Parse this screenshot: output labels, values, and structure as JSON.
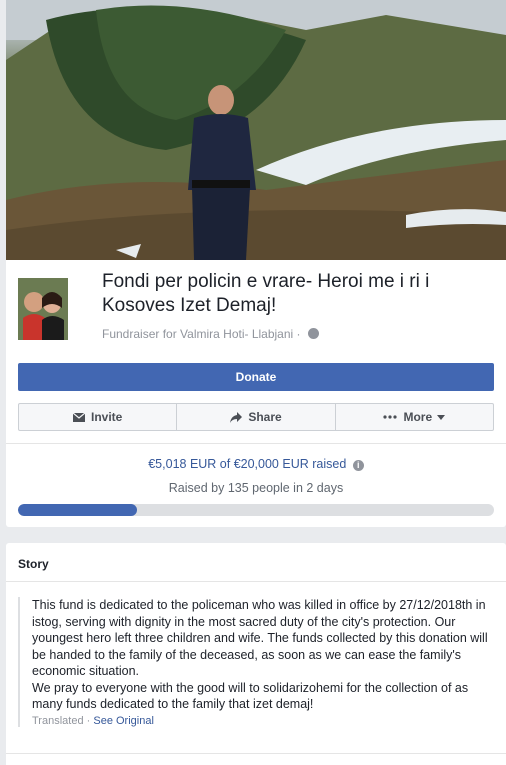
{
  "fundraiser": {
    "title": "Fondi per policin e vrare- Heroi me i ri i Kosoves Izet Demaj!",
    "subtitle": "Fundraiser for Valmira Hoti- Llabjani ·",
    "privacy_icon": "globe-icon"
  },
  "buttons": {
    "donate": "Donate",
    "invite": "Invite",
    "share": "Share",
    "more": "More"
  },
  "progress": {
    "raised_text": "€5,018 EUR of €20,000 EUR raised",
    "people_text": "Raised by 135 people in 2 days",
    "fraction": 0.2509
  },
  "story": {
    "heading": "Story",
    "text": "This fund is dedicated to the policeman who was killed in office by 27/12/2018th in istog, serving with dignity in the most sacred duty of the city's protection. Our youngest hero left three children and wife. The funds collected by this donation will be handed to the family of the deceased, as soon as we can ease the family's economic situation.\nWe pray to everyone with the good will to solidarizohemi for the collection of as many funds dedicated to the family that izet demaj!",
    "translated_label": "Translated ·",
    "see_original": "See Original"
  },
  "colors": {
    "accent": "#4267b2",
    "link": "#365899",
    "page_bg": "#e9ebee"
  }
}
